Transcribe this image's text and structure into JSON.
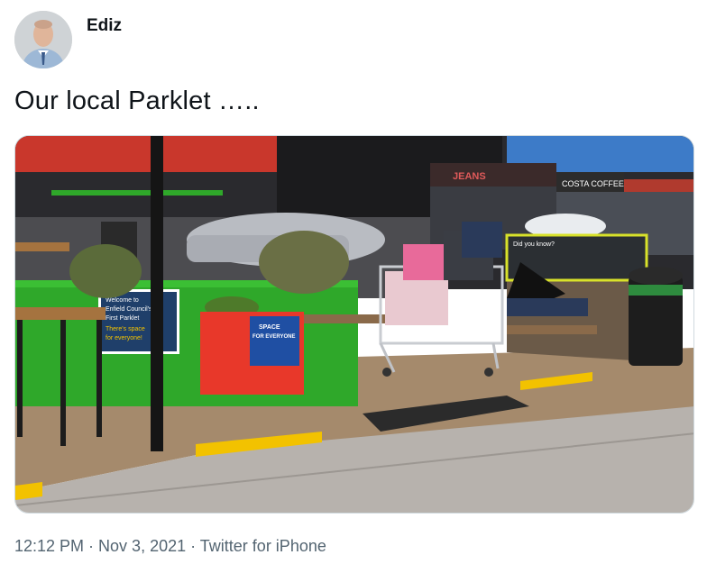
{
  "author": {
    "name": "Ediz",
    "avatar_icon": "profile-photo"
  },
  "tweet": {
    "text": "Our local Parklet ….."
  },
  "media": {
    "sign_welcome": [
      "Welcome to",
      "Enfield Council's",
      "First Parklet",
      "There's space",
      "for everyone!"
    ],
    "planter_sign": [
      "SPACE",
      "FOR EVERYONE"
    ],
    "info_board_title": "Did you know?",
    "shop_sign_1": "COSTA COFFEE",
    "shop_sign_2": "JEANS"
  },
  "meta": {
    "time": "12:12 PM",
    "separator": " · ",
    "date": "Nov 3, 2021",
    "source": "Twitter for iPhone"
  },
  "colors": {
    "text_primary": "#0f1419",
    "text_secondary": "#536471",
    "planter_green": "#2fa82a",
    "planter_red": "#e8382a",
    "curb_yellow": "#f2c200"
  }
}
